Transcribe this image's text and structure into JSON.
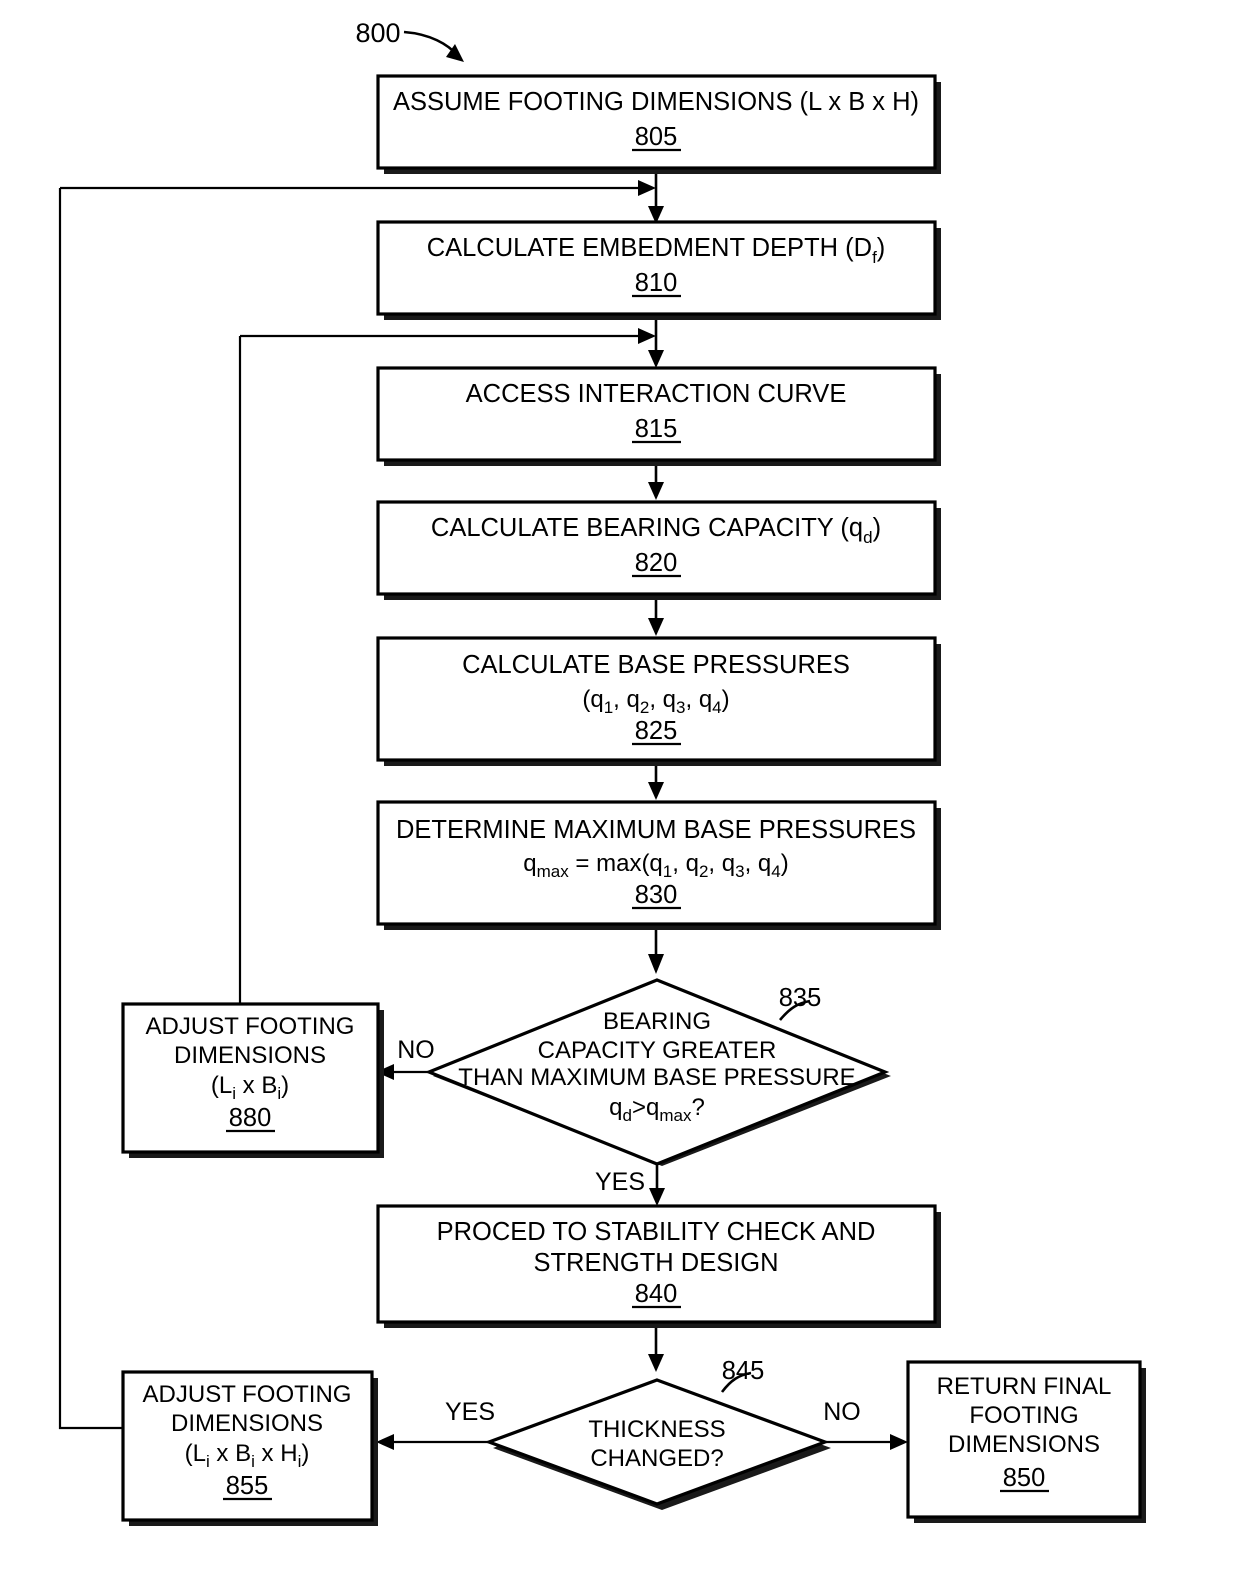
{
  "figure": {
    "number": "800"
  },
  "nodes": {
    "n805": {
      "line1": "ASSUME FOOTING DIMENSIONS (L x B x H)",
      "ref": "805"
    },
    "n810": {
      "line1_a": "CALCULATE EMBEDMENT DEPTH (D",
      "line1_sub": "f",
      "line1_b": ")",
      "ref": "810"
    },
    "n815": {
      "line1": "ACCESS INTERACTION CURVE",
      "ref": "815"
    },
    "n820": {
      "line1_a": "CALCULATE BEARING CAPACITY (q",
      "line1_sub": "d",
      "line1_b": ")",
      "ref": "820"
    },
    "n825": {
      "line1": "CALCULATE BASE PRESSURES",
      "line2": "(q1, q2, q3, q4)",
      "ref": "825"
    },
    "n830": {
      "line1": "DETERMINE MAXIMUM BASE PRESSURES",
      "line2": "qmax = max(q1, q2, q3, q4)",
      "ref": "830"
    },
    "n835": {
      "line1": "BEARING",
      "line2": "CAPACITY GREATER",
      "line3": "THAN MAXIMUM BASE PRESSURE",
      "line4": "qd>qmax?",
      "ref": "835"
    },
    "n880": {
      "line1": "ADJUST FOOTING",
      "line2": "DIMENSIONS",
      "line3": "(Li x Bi)",
      "ref": "880"
    },
    "n840": {
      "line1": "PROCED TO STABILITY CHECK AND",
      "line2": "STRENGTH DESIGN",
      "ref": "840"
    },
    "n845": {
      "line1": "THICKNESS",
      "line2": "CHANGED?",
      "ref": "845"
    },
    "n855": {
      "line1": "ADJUST FOOTING",
      "line2": "DIMENSIONS",
      "line3": "(Li x Bi x Hi)",
      "ref": "855"
    },
    "n850": {
      "line1": "RETURN FINAL",
      "line2": "FOOTING",
      "line3": "DIMENSIONS",
      "ref": "850"
    }
  },
  "edge_labels": {
    "no_835": "NO",
    "yes_835": "YES",
    "yes_845": "YES",
    "no_845": "NO"
  },
  "colors": {
    "stroke": "#000000",
    "fill": "#ffffff",
    "shadow": "#1a1a1a"
  }
}
